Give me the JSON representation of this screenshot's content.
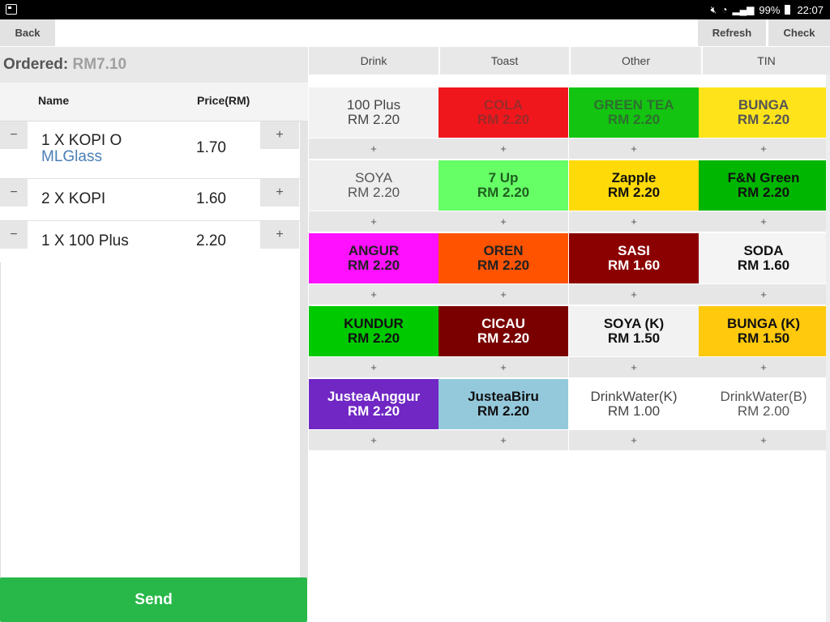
{
  "status_bar": {
    "battery": "99%",
    "time": "22:07"
  },
  "toolbar": {
    "back_label": "Back",
    "refresh_label": "Refresh",
    "check_label": "Check"
  },
  "order": {
    "ordered_label": "Ordered:",
    "ordered_total": "RM7.10",
    "col_name": "Name",
    "col_price": "Price(RM)",
    "minus_symbol": "−",
    "plus_symbol": "+",
    "items": [
      {
        "name": "1 X KOPI O",
        "note": "MLGlass",
        "price": "1.70"
      },
      {
        "name": "2 X KOPI",
        "note": "",
        "price": "1.60"
      },
      {
        "name": "1 X 100 Plus",
        "note": "",
        "price": "2.20"
      }
    ],
    "send_label": "Send"
  },
  "menu": {
    "tabs": [
      "Drink",
      "Toast",
      "Other",
      "TIN"
    ],
    "add_symbol": "+",
    "items": [
      {
        "name": "100 Plus",
        "price": "RM 2.20",
        "bg": "#f2f2f2",
        "fg": "#444444"
      },
      {
        "name": "COLA",
        "price": "RM 2.20",
        "bg": "#f0171c",
        "fg": "#9b2b2b"
      },
      {
        "name": "GREEN TEA",
        "price": "RM 2.20",
        "bg": "#13c411",
        "fg": "#2f6f2f"
      },
      {
        "name": "BUNGA",
        "price": "RM 2.20",
        "bg": "#ffe31a",
        "fg": "#555555"
      },
      {
        "name": "SOYA",
        "price": "RM 2.20",
        "bg": "#eeeeee",
        "fg": "#555555"
      },
      {
        "name": "7 Up",
        "price": "RM 2.20",
        "bg": "#66ff66",
        "fg": "#1f5f1f"
      },
      {
        "name": "Zapple",
        "price": "RM 2.20",
        "bg": "#ffda09",
        "fg": "#111111"
      },
      {
        "name": "F&N Green",
        "price": "RM 2.20",
        "bg": "#00b600",
        "fg": "#111111"
      },
      {
        "name": "ANGUR",
        "price": "RM 2.20",
        "bg": "#ff10ff",
        "fg": "#222222"
      },
      {
        "name": "OREN",
        "price": "RM 2.20",
        "bg": "#ff5300",
        "fg": "#222222"
      },
      {
        "name": "SASI",
        "price": "RM 1.60",
        "bg": "#8b0000",
        "fg": "#ffffff"
      },
      {
        "name": "SODA",
        "price": "RM 1.60",
        "bg": "#f4f4f4",
        "fg": "#111111"
      },
      {
        "name": "KUNDUR",
        "price": "RM 2.20",
        "bg": "#00c900",
        "fg": "#111111"
      },
      {
        "name": "CICAU",
        "price": "RM 2.20",
        "bg": "#7a0000",
        "fg": "#ffffff"
      },
      {
        "name": "SOYA (K)",
        "price": "RM 1.50",
        "bg": "#f2f2f2",
        "fg": "#111111"
      },
      {
        "name": "BUNGA (K)",
        "price": "RM 1.50",
        "bg": "#ffc90e",
        "fg": "#111111"
      },
      {
        "name": "JusteaAnggur",
        "price": "RM 2.20",
        "bg": "#7027c4",
        "fg": "#ffffff"
      },
      {
        "name": "JusteaBiru",
        "price": "RM 2.20",
        "bg": "#94c9dc",
        "fg": "#111111"
      },
      {
        "name": "DrinkWater(K)",
        "price": "RM 1.00",
        "bg": "#ffffff",
        "fg": "#444444"
      },
      {
        "name": "DrinkWater(B)",
        "price": "RM 2.00",
        "bg": "#ffffff",
        "fg": "#555555"
      }
    ]
  }
}
